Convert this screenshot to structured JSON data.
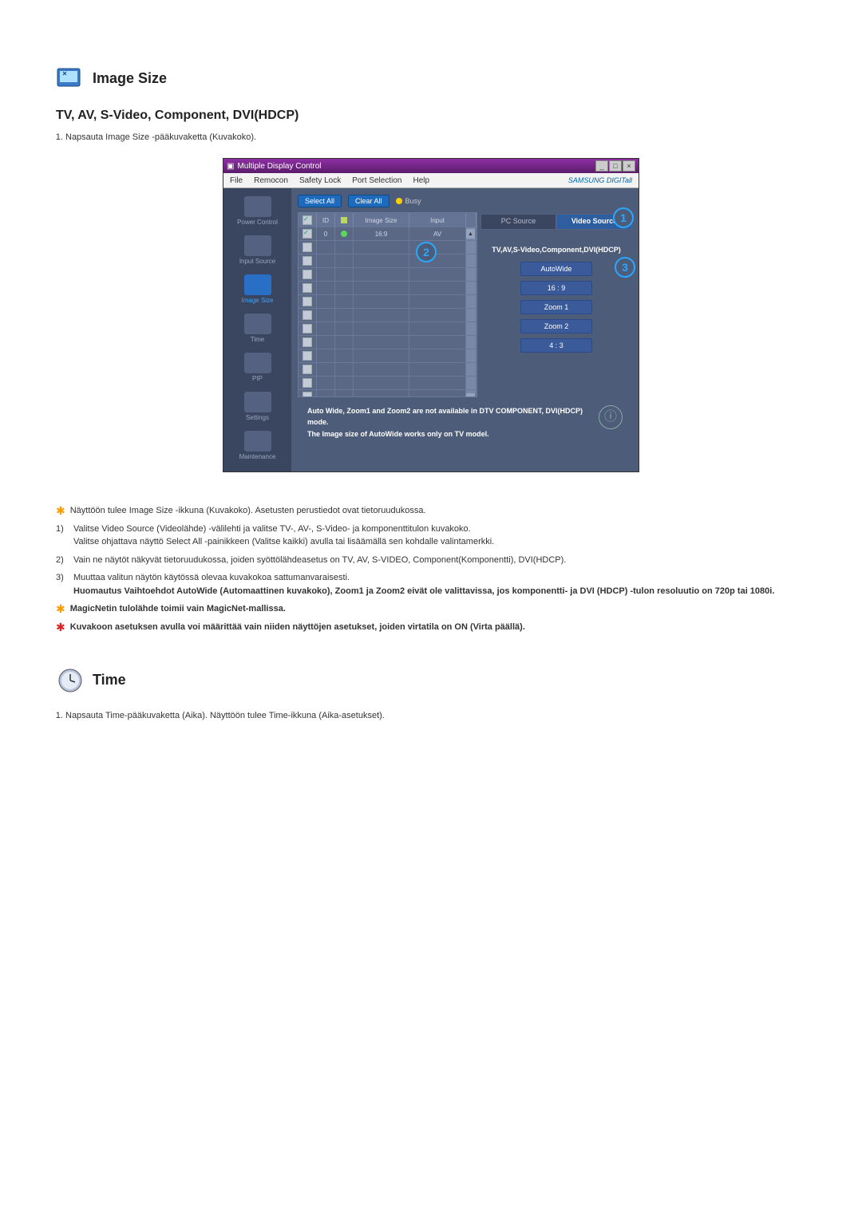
{
  "section1": {
    "title": "Image Size",
    "subheading": "TV, AV, S-Video, Component, DVI(HDCP)",
    "step1": "Napsauta Image Size -pääkuvaketta (Kuvakoko)."
  },
  "window": {
    "title": "Multiple Display Control",
    "menu": {
      "file": "File",
      "remocon": "Remocon",
      "safety": "Safety Lock",
      "port": "Port Selection",
      "help": "Help"
    },
    "brand": "SAMSUNG DIGITall",
    "sidebar": {
      "power": "Power Control",
      "input": "Input Source",
      "image": "Image Size",
      "time": "Time",
      "pip": "PIP",
      "settings": "Settings",
      "maint": "Maintenance"
    },
    "toolbar": {
      "select_all": "Select All",
      "clear_all": "Clear All",
      "busy": "Busy"
    },
    "grid": {
      "headers": {
        "id": "ID",
        "image_size": "Image Size",
        "input": "Input"
      },
      "row0": {
        "id": "0",
        "image_size": "16:9",
        "input": "AV"
      }
    },
    "right": {
      "tab_pc": "PC Source",
      "tab_video": "Video Source",
      "label": "TV,AV,S-Video,Component,DVI(HDCP)",
      "opts": {
        "autowide": "AutoWide",
        "r169": "16 : 9",
        "zoom1": "Zoom 1",
        "zoom2": "Zoom 2",
        "r43": "4 : 3"
      }
    },
    "footer": {
      "l1": "Auto Wide, Zoom1 and Zoom2 are not available in DTV COMPONENT, DVI(HDCP) mode.",
      "l2": "The Image size of AutoWide works only on TV model."
    },
    "badges": {
      "b1": "1",
      "b2": "2",
      "b3": "3"
    }
  },
  "notes": {
    "n0": "Näyttöön tulee Image Size -ikkuna (Kuvakoko). Asetusten perustiedot ovat tietoruudukossa.",
    "n1a": "Valitse Video Source (Videolähde) -välilehti ja valitse TV-, AV-, S-Video- ja komponenttitulon kuvakoko.",
    "n1b": "Valitse ohjattava näyttö Select All -painikkeen (Valitse kaikki) avulla tai lisäämällä sen kohdalle valintamerkki.",
    "n2": "Vain ne näytöt näkyvät tietoruudukossa, joiden syöttölähdeasetus on TV, AV, S-VIDEO, Component(Komponentti), DVI(HDCP).",
    "n3": "Muuttaa valitun näytön käytössä olevaa kuvakokoa sattumanvaraisesti.",
    "n3b": "Huomautus Vaihtoehdot AutoWide (Automaattinen kuvakoko), Zoom1 ja Zoom2 eivät ole valittavissa, jos komponentti- ja DVI (HDCP) -tulon resoluutio on 720p tai 1080i.",
    "magicnet": "MagicNetin tulolähde toimii vain MagicNet-mallissa.",
    "power": "Kuvakoon asetuksen avulla voi määrittää vain niiden näyttöjen asetukset, joiden virtatila on ON (Virta päällä).",
    "num1": "1)",
    "num2": "2)",
    "num3": "3)"
  },
  "section2": {
    "title": "Time",
    "step1": "Napsauta Time-pääkuvaketta (Aika). Näyttöön tulee Time-ikkuna (Aika-asetukset)."
  }
}
